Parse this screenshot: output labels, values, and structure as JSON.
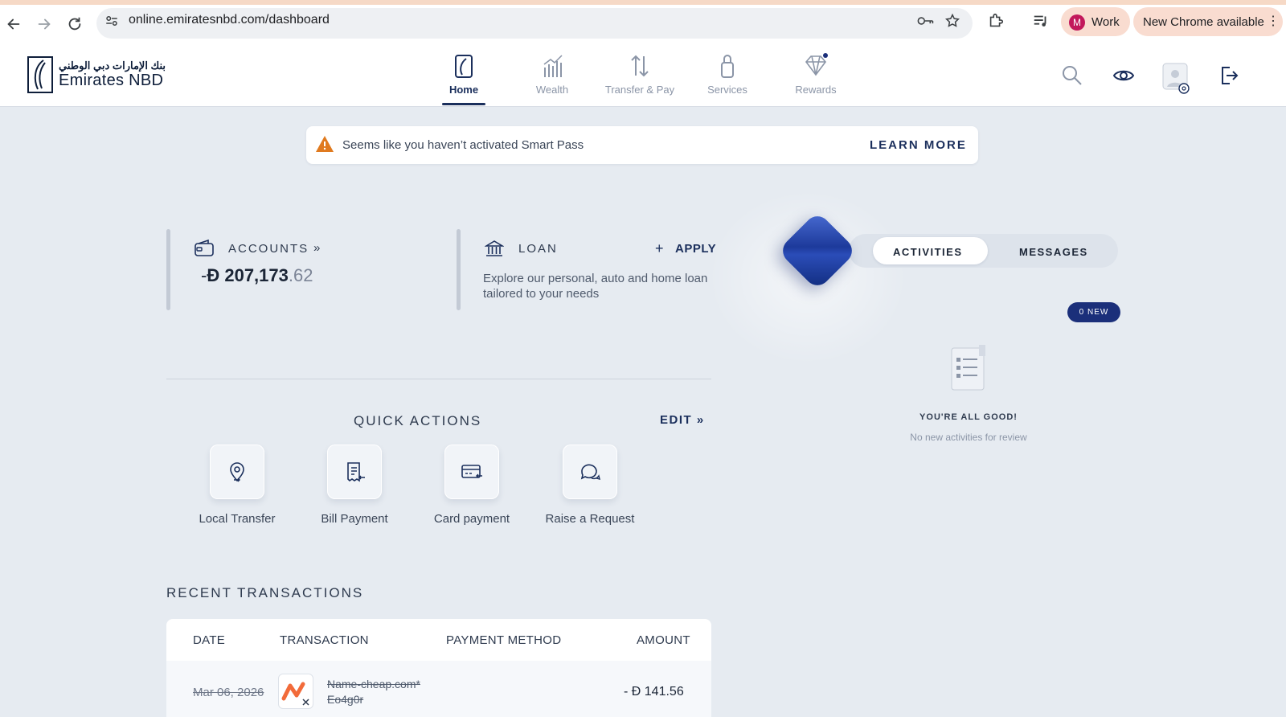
{
  "browser": {
    "url": "online.emiratesnbd.com/dashboard",
    "profile_initial": "M",
    "profile_label": "Work",
    "update_label": "New Chrome available"
  },
  "header": {
    "logo_arabic": "بنك الإمارات دبي الوطني",
    "logo_text": "Emirates NBD",
    "tabs": [
      {
        "label": "Home",
        "icon": "home-icon",
        "active": true
      },
      {
        "label": "Wealth",
        "icon": "wealth-chart-icon"
      },
      {
        "label": "Transfer & Pay",
        "icon": "transfer-arrows-icon"
      },
      {
        "label": "Services",
        "icon": "services-icon"
      },
      {
        "label": "Rewards",
        "icon": "diamond-icon"
      }
    ]
  },
  "banner": {
    "text": "Seems like you haven’t activated Smart Pass",
    "action": "LEARN MORE"
  },
  "accounts": {
    "label": "ACCOUNTS",
    "sign": "-",
    "currency": "Đ",
    "amount_int": "207,173",
    "amount_dec": ".62"
  },
  "loan": {
    "label": "LOAN",
    "apply": "APPLY",
    "description": "Explore our personal, auto and home loan tailored to your needs"
  },
  "quick_actions": {
    "title": "QUICK ACTIONS",
    "edit": "EDIT",
    "items": [
      {
        "label": "Local Transfer",
        "icon": "location-transfer-icon"
      },
      {
        "label": "Bill Payment",
        "icon": "bill-icon"
      },
      {
        "label": "Card payment",
        "icon": "card-payment-icon"
      },
      {
        "label": "Raise a Request",
        "icon": "chat-bubbles-icon"
      }
    ]
  },
  "transactions": {
    "title": "RECENT TRANSACTIONS",
    "columns": [
      "DATE",
      "TRANSACTION",
      "PAYMENT METHOD",
      "AMOUNT"
    ],
    "rows": [
      {
        "date": "Mar 06, 2026",
        "name": "Name-cheap.com* Eo4g0r",
        "method": "",
        "amount": "- Đ 141.56"
      }
    ]
  },
  "activity_panel": {
    "tabs": [
      "ACTIVITIES",
      "MESSAGES"
    ],
    "active_tab": "ACTIVITIES",
    "badge": "0 NEW",
    "empty_title": "YOU'RE ALL GOOD!",
    "empty_sub": "No new activities for review"
  },
  "colors": {
    "brand_navy": "#1b2f5c",
    "page_bg": "#e6ebf1",
    "badge_bg": "#1b2f7a",
    "warning": "#e07a1f"
  }
}
